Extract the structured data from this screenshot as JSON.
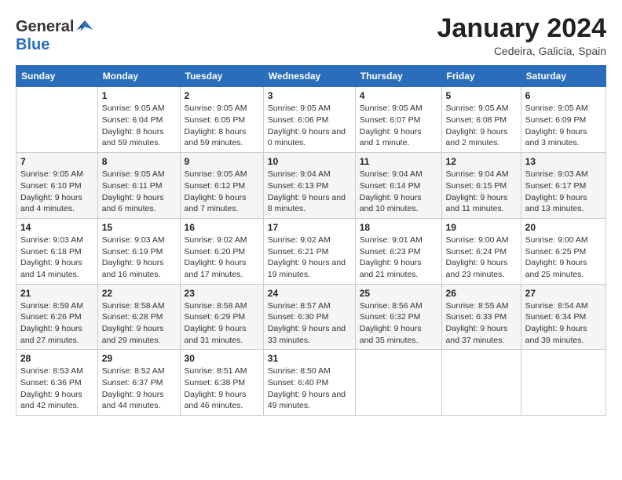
{
  "logo": {
    "general": "General",
    "blue": "Blue"
  },
  "title": "January 2024",
  "subtitle": "Cedeira, Galicia, Spain",
  "columns": [
    "Sunday",
    "Monday",
    "Tuesday",
    "Wednesday",
    "Thursday",
    "Friday",
    "Saturday"
  ],
  "weeks": [
    [
      {
        "day": "",
        "sunrise": "",
        "sunset": "",
        "daylight": ""
      },
      {
        "day": "1",
        "sunrise": "Sunrise: 9:05 AM",
        "sunset": "Sunset: 6:04 PM",
        "daylight": "Daylight: 8 hours and 59 minutes."
      },
      {
        "day": "2",
        "sunrise": "Sunrise: 9:05 AM",
        "sunset": "Sunset: 6:05 PM",
        "daylight": "Daylight: 8 hours and 59 minutes."
      },
      {
        "day": "3",
        "sunrise": "Sunrise: 9:05 AM",
        "sunset": "Sunset: 6:06 PM",
        "daylight": "Daylight: 9 hours and 0 minutes."
      },
      {
        "day": "4",
        "sunrise": "Sunrise: 9:05 AM",
        "sunset": "Sunset: 6:07 PM",
        "daylight": "Daylight: 9 hours and 1 minute."
      },
      {
        "day": "5",
        "sunrise": "Sunrise: 9:05 AM",
        "sunset": "Sunset: 6:08 PM",
        "daylight": "Daylight: 9 hours and 2 minutes."
      },
      {
        "day": "6",
        "sunrise": "Sunrise: 9:05 AM",
        "sunset": "Sunset: 6:09 PM",
        "daylight": "Daylight: 9 hours and 3 minutes."
      }
    ],
    [
      {
        "day": "7",
        "sunrise": "Sunrise: 9:05 AM",
        "sunset": "Sunset: 6:10 PM",
        "daylight": "Daylight: 9 hours and 4 minutes."
      },
      {
        "day": "8",
        "sunrise": "Sunrise: 9:05 AM",
        "sunset": "Sunset: 6:11 PM",
        "daylight": "Daylight: 9 hours and 6 minutes."
      },
      {
        "day": "9",
        "sunrise": "Sunrise: 9:05 AM",
        "sunset": "Sunset: 6:12 PM",
        "daylight": "Daylight: 9 hours and 7 minutes."
      },
      {
        "day": "10",
        "sunrise": "Sunrise: 9:04 AM",
        "sunset": "Sunset: 6:13 PM",
        "daylight": "Daylight: 9 hours and 8 minutes."
      },
      {
        "day": "11",
        "sunrise": "Sunrise: 9:04 AM",
        "sunset": "Sunset: 6:14 PM",
        "daylight": "Daylight: 9 hours and 10 minutes."
      },
      {
        "day": "12",
        "sunrise": "Sunrise: 9:04 AM",
        "sunset": "Sunset: 6:15 PM",
        "daylight": "Daylight: 9 hours and 11 minutes."
      },
      {
        "day": "13",
        "sunrise": "Sunrise: 9:03 AM",
        "sunset": "Sunset: 6:17 PM",
        "daylight": "Daylight: 9 hours and 13 minutes."
      }
    ],
    [
      {
        "day": "14",
        "sunrise": "Sunrise: 9:03 AM",
        "sunset": "Sunset: 6:18 PM",
        "daylight": "Daylight: 9 hours and 14 minutes."
      },
      {
        "day": "15",
        "sunrise": "Sunrise: 9:03 AM",
        "sunset": "Sunset: 6:19 PM",
        "daylight": "Daylight: 9 hours and 16 minutes."
      },
      {
        "day": "16",
        "sunrise": "Sunrise: 9:02 AM",
        "sunset": "Sunset: 6:20 PM",
        "daylight": "Daylight: 9 hours and 17 minutes."
      },
      {
        "day": "17",
        "sunrise": "Sunrise: 9:02 AM",
        "sunset": "Sunset: 6:21 PM",
        "daylight": "Daylight: 9 hours and 19 minutes."
      },
      {
        "day": "18",
        "sunrise": "Sunrise: 9:01 AM",
        "sunset": "Sunset: 6:23 PM",
        "daylight": "Daylight: 9 hours and 21 minutes."
      },
      {
        "day": "19",
        "sunrise": "Sunrise: 9:00 AM",
        "sunset": "Sunset: 6:24 PM",
        "daylight": "Daylight: 9 hours and 23 minutes."
      },
      {
        "day": "20",
        "sunrise": "Sunrise: 9:00 AM",
        "sunset": "Sunset: 6:25 PM",
        "daylight": "Daylight: 9 hours and 25 minutes."
      }
    ],
    [
      {
        "day": "21",
        "sunrise": "Sunrise: 8:59 AM",
        "sunset": "Sunset: 6:26 PM",
        "daylight": "Daylight: 9 hours and 27 minutes."
      },
      {
        "day": "22",
        "sunrise": "Sunrise: 8:58 AM",
        "sunset": "Sunset: 6:28 PM",
        "daylight": "Daylight: 9 hours and 29 minutes."
      },
      {
        "day": "23",
        "sunrise": "Sunrise: 8:58 AM",
        "sunset": "Sunset: 6:29 PM",
        "daylight": "Daylight: 9 hours and 31 minutes."
      },
      {
        "day": "24",
        "sunrise": "Sunrise: 8:57 AM",
        "sunset": "Sunset: 6:30 PM",
        "daylight": "Daylight: 9 hours and 33 minutes."
      },
      {
        "day": "25",
        "sunrise": "Sunrise: 8:56 AM",
        "sunset": "Sunset: 6:32 PM",
        "daylight": "Daylight: 9 hours and 35 minutes."
      },
      {
        "day": "26",
        "sunrise": "Sunrise: 8:55 AM",
        "sunset": "Sunset: 6:33 PM",
        "daylight": "Daylight: 9 hours and 37 minutes."
      },
      {
        "day": "27",
        "sunrise": "Sunrise: 8:54 AM",
        "sunset": "Sunset: 6:34 PM",
        "daylight": "Daylight: 9 hours and 39 minutes."
      }
    ],
    [
      {
        "day": "28",
        "sunrise": "Sunrise: 8:53 AM",
        "sunset": "Sunset: 6:36 PM",
        "daylight": "Daylight: 9 hours and 42 minutes."
      },
      {
        "day": "29",
        "sunrise": "Sunrise: 8:52 AM",
        "sunset": "Sunset: 6:37 PM",
        "daylight": "Daylight: 9 hours and 44 minutes."
      },
      {
        "day": "30",
        "sunrise": "Sunrise: 8:51 AM",
        "sunset": "Sunset: 6:38 PM",
        "daylight": "Daylight: 9 hours and 46 minutes."
      },
      {
        "day": "31",
        "sunrise": "Sunrise: 8:50 AM",
        "sunset": "Sunset: 6:40 PM",
        "daylight": "Daylight: 9 hours and 49 minutes."
      },
      {
        "day": "",
        "sunrise": "",
        "sunset": "",
        "daylight": ""
      },
      {
        "day": "",
        "sunrise": "",
        "sunset": "",
        "daylight": ""
      },
      {
        "day": "",
        "sunrise": "",
        "sunset": "",
        "daylight": ""
      }
    ]
  ]
}
